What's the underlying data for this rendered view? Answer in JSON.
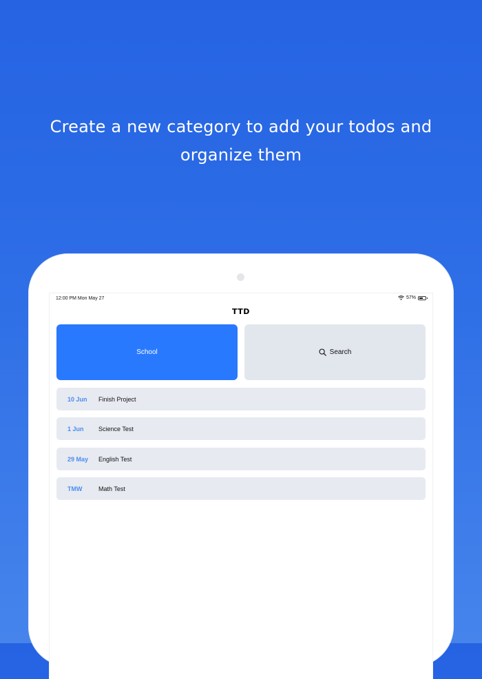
{
  "headline": {
    "line1": "Create a new category to add your todos and",
    "line2": "organize them"
  },
  "status_bar": {
    "time": "12:00 PM   Mon May 27",
    "battery": "57%",
    "battery_level": 0.57
  },
  "app": {
    "title": "TTD"
  },
  "tiles": {
    "category_label": "School",
    "search_label": "Search"
  },
  "todos": [
    {
      "date": "10 Jun",
      "title": "Finish Project"
    },
    {
      "date": "1 Jun",
      "title": "Science Test"
    },
    {
      "date": "29 May",
      "title": "English Test"
    },
    {
      "date": "TMW",
      "title": "Math Test"
    }
  ],
  "colors": {
    "background": "#2563E3",
    "accent": "#2979FF",
    "date_text": "#4A8DF0",
    "row_bg": "#E7EAF1"
  },
  "icons": [
    "wifi-icon",
    "battery-icon",
    "search-icon"
  ]
}
